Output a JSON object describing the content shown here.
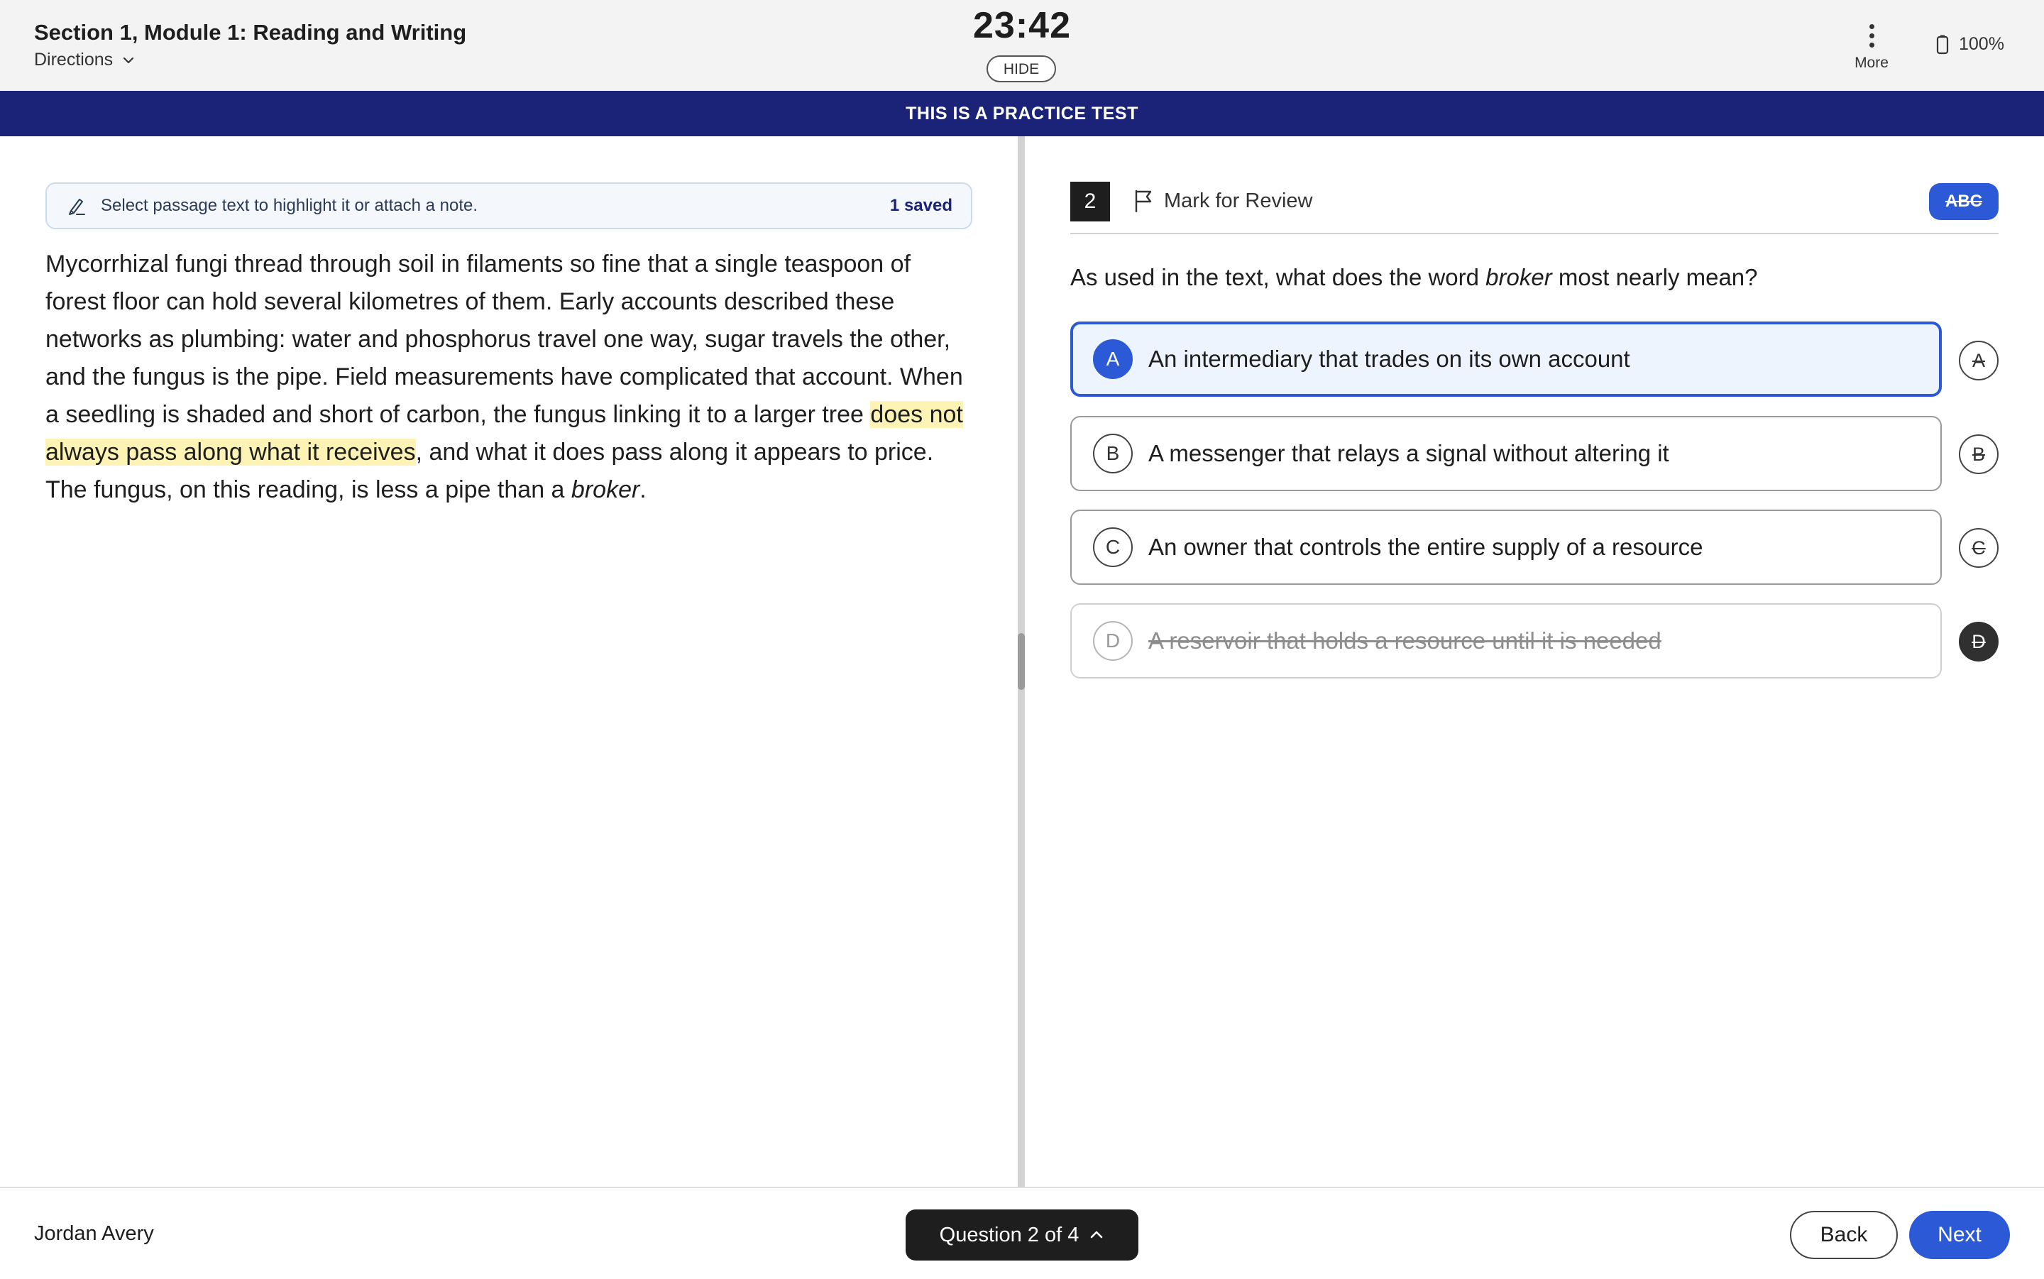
{
  "header": {
    "section_title": "Section 1, Module 1: Reading and Writing",
    "directions_label": "Directions",
    "timer": "23:42",
    "hide_label": "HIDE",
    "more_label": "More",
    "battery_level": "100%"
  },
  "banner": {
    "text": "THIS IS A PRACTICE TEST"
  },
  "annotation_bar": {
    "hint": "Select passage text to highlight it or attach a note.",
    "saved": "1 saved"
  },
  "passage": {
    "before_highlight": "Mycorrhizal fungi thread through soil in filaments so fine that a single teaspoon of forest floor can hold several kilometres of them. Early accounts described these networks as plumbing: water and phosphorus travel one way, sugar travels the other, and the fungus is the pipe. Field measurements have complicated that account. When a seedling is shaded and short of carbon, the fungus linking it to a larger tree ",
    "highlight": "does not always pass along what it receives",
    "after_highlight": ", and what it does pass along it appears to price. The fungus, on this reading, is less a pipe than a ",
    "italic_word": "broker",
    "end": "."
  },
  "question": {
    "number": "2",
    "mark_for_review_label": "Mark for Review",
    "abc_label": "ABC",
    "prompt_before": "As used in the text, what does the word ",
    "prompt_italic": "broker",
    "prompt_after": " most nearly mean?",
    "choices": [
      {
        "letter": "A",
        "text": "An intermediary that trades on its own account",
        "state": "selected"
      },
      {
        "letter": "B",
        "text": "A messenger that relays a signal without altering it",
        "state": "normal"
      },
      {
        "letter": "C",
        "text": "An owner that controls the entire supply of a resource",
        "state": "normal"
      },
      {
        "letter": "D",
        "text": "A reservoir that holds a resource until it is needed",
        "state": "eliminated"
      }
    ]
  },
  "footer": {
    "student_name": "Jordan Avery",
    "question_nav_label": "Question 2 of 4",
    "back_label": "Back",
    "next_label": "Next"
  },
  "colors": {
    "banner": "#1a2378",
    "accent": "#2c59d6",
    "highlight": "#fdf3b4"
  }
}
